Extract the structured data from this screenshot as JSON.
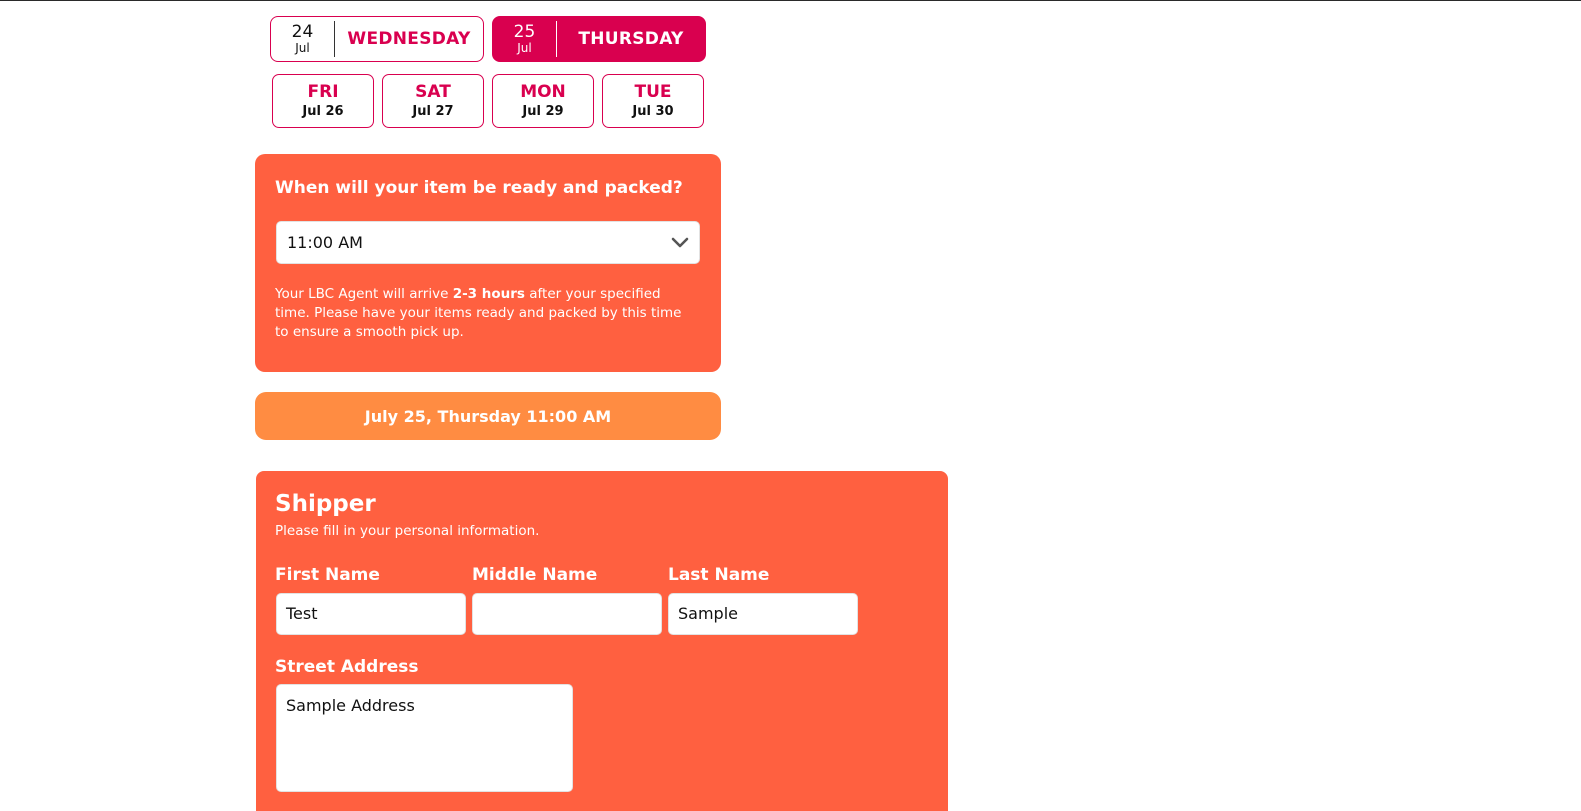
{
  "days": {
    "primary": [
      {
        "num": "24",
        "month": "Jul",
        "name": "WEDNESDAY",
        "selected": false
      },
      {
        "num": "25",
        "month": "Jul",
        "name": "THURSDAY",
        "selected": true
      }
    ],
    "more": [
      {
        "name": "FRI",
        "date": "Jul 26"
      },
      {
        "name": "SAT",
        "date": "Jul 27"
      },
      {
        "name": "MON",
        "date": "Jul 29"
      },
      {
        "name": "TUE",
        "date": "Jul 30"
      }
    ]
  },
  "ready": {
    "title": "When will your item be ready and packed?",
    "time_value": "11:00 AM",
    "note_before": "Your LBC Agent will arrive ",
    "note_bold": "2-3 hours",
    "note_after": " after your specified time. Please have your items ready and packed by this time to ensure a smooth pick up."
  },
  "summary": {
    "text": "July 25, Thursday 11:00 AM"
  },
  "shipper": {
    "title": "Shipper",
    "subtitle": "Please fill in your personal information.",
    "first_name_label": "First Name",
    "first_name_value": "Test",
    "middle_name_label": "Middle Name",
    "middle_name_value": "",
    "last_name_label": "Last Name",
    "last_name_value": "Sample",
    "street_label": "Street Address",
    "street_value": "Sample Address"
  },
  "colors": {
    "brand_magenta": "#d9004f",
    "card_orange_red": "#ff6040",
    "summary_orange": "#ff8c42"
  },
  "icons": {
    "dropdown": "chevron-down-icon"
  }
}
